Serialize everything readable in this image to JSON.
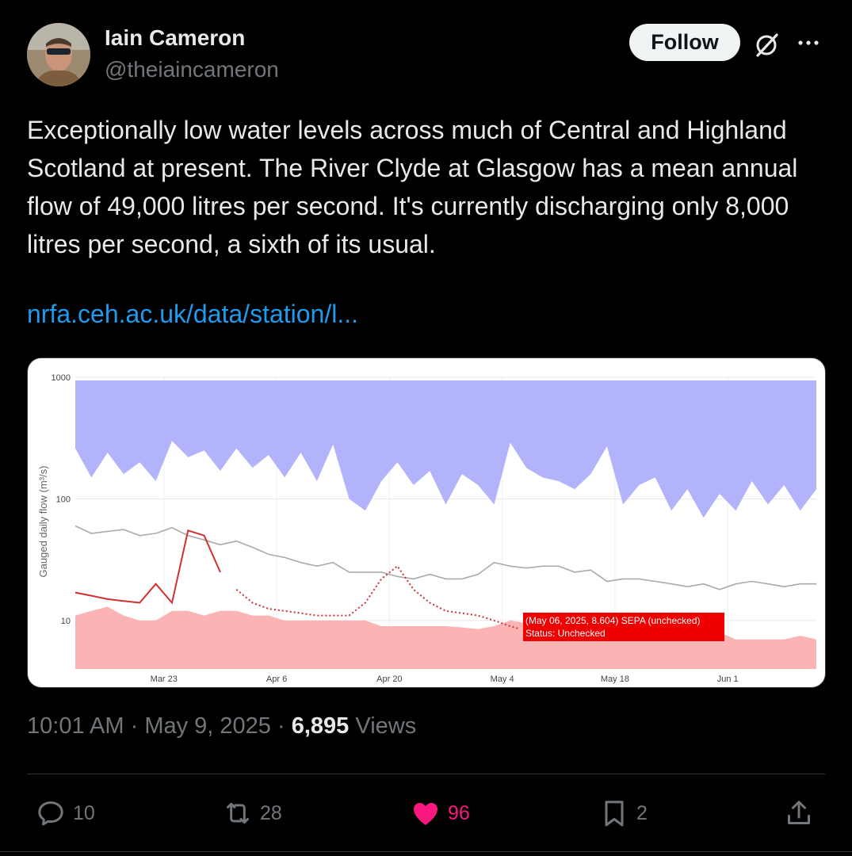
{
  "author": {
    "name": "Iain Cameron",
    "handle": "@theiaincameron"
  },
  "header": {
    "follow_label": "Follow",
    "grok_icon": "grok-icon",
    "more_icon": "more-icon"
  },
  "tweet": {
    "text": "Exceptionally low water levels across much of Central and Highland Scotland at present. The River Clyde at Glasgow has a mean annual flow of 49,000 litres per second. It's currently discharging only 8,000 litres per second, a sixth of its usual.",
    "link": "nrfa.ceh.ac.uk/data/station/l..."
  },
  "chart_data": {
    "type": "area",
    "ylabel": "Gauged daily flow (m³/s)",
    "yscale": "log",
    "ylim": [
      4,
      1000
    ],
    "ytick_labels": [
      "1000",
      "100",
      "10"
    ],
    "yticks": [
      1000,
      100,
      10
    ],
    "xtick_labels": [
      "Mar 23",
      "Apr 6",
      "Apr 20",
      "May 4",
      "May 18",
      "Jun 1"
    ],
    "xlim_days": [
      "2025-03-12",
      "2025-06-12"
    ],
    "grid": true,
    "series": [
      {
        "style": "band-upper",
        "color": "#b3b3fb",
        "x": [
          "2025-03-12",
          "2025-03-14",
          "2025-03-16",
          "2025-03-18",
          "2025-03-20",
          "2025-03-22",
          "2025-03-24",
          "2025-03-26",
          "2025-03-28",
          "2025-03-30",
          "2025-04-01",
          "2025-04-03",
          "2025-04-05",
          "2025-04-07",
          "2025-04-09",
          "2025-04-11",
          "2025-04-13",
          "2025-04-15",
          "2025-04-17",
          "2025-04-19",
          "2025-04-21",
          "2025-04-23",
          "2025-04-25",
          "2025-04-27",
          "2025-04-29",
          "2025-05-01",
          "2025-05-03",
          "2025-05-05",
          "2025-05-07",
          "2025-05-09",
          "2025-05-11",
          "2025-05-13",
          "2025-05-15",
          "2025-05-17",
          "2025-05-19",
          "2025-05-21",
          "2025-05-23",
          "2025-05-25",
          "2025-05-27",
          "2025-05-29",
          "2025-05-31",
          "2025-06-02",
          "2025-06-04",
          "2025-06-06",
          "2025-06-08",
          "2025-06-10",
          "2025-06-12"
        ],
        "values": [
          260,
          150,
          240,
          160,
          200,
          140,
          300,
          220,
          250,
          170,
          260,
          180,
          230,
          150,
          240,
          140,
          280,
          100,
          80,
          140,
          200,
          130,
          170,
          90,
          160,
          130,
          90,
          290,
          180,
          150,
          140,
          120,
          160,
          270,
          90,
          130,
          150,
          80,
          120,
          70,
          110,
          80,
          140,
          90,
          130,
          80,
          120
        ]
      },
      {
        "style": "band-lower",
        "color": "#fbb3b3",
        "x": [
          "2025-03-12",
          "2025-03-14",
          "2025-03-16",
          "2025-03-18",
          "2025-03-20",
          "2025-03-22",
          "2025-03-24",
          "2025-03-26",
          "2025-03-28",
          "2025-03-30",
          "2025-04-01",
          "2025-04-03",
          "2025-04-05",
          "2025-04-07",
          "2025-04-09",
          "2025-04-11",
          "2025-04-13",
          "2025-04-15",
          "2025-04-17",
          "2025-04-19",
          "2025-04-21",
          "2025-04-23",
          "2025-04-25",
          "2025-04-27",
          "2025-04-29",
          "2025-05-01",
          "2025-05-03",
          "2025-05-05",
          "2025-05-07",
          "2025-05-09",
          "2025-05-11",
          "2025-05-13",
          "2025-05-15",
          "2025-05-17",
          "2025-05-19",
          "2025-05-21",
          "2025-05-23",
          "2025-05-25",
          "2025-05-27",
          "2025-05-29",
          "2025-05-31",
          "2025-06-02",
          "2025-06-04",
          "2025-06-06",
          "2025-06-08",
          "2025-06-10",
          "2025-06-12"
        ],
        "values": [
          11,
          12,
          13,
          11,
          10,
          10,
          12,
          12,
          11,
          12,
          12,
          11,
          11,
          10,
          10,
          10,
          10,
          10,
          10,
          9,
          9,
          9,
          9,
          9,
          8.8,
          8.5,
          9,
          10,
          9.5,
          9,
          9,
          8.5,
          8.5,
          8.5,
          8.5,
          8.5,
          8.5,
          8.5,
          8,
          8,
          8,
          7,
          7,
          7,
          7,
          7.5,
          7
        ]
      },
      {
        "style": "mean",
        "color": "#aaaaaa",
        "x": [
          "2025-03-12",
          "2025-03-14",
          "2025-03-16",
          "2025-03-18",
          "2025-03-20",
          "2025-03-22",
          "2025-03-24",
          "2025-03-26",
          "2025-03-28",
          "2025-03-30",
          "2025-04-01",
          "2025-04-03",
          "2025-04-05",
          "2025-04-07",
          "2025-04-09",
          "2025-04-11",
          "2025-04-13",
          "2025-04-15",
          "2025-04-17",
          "2025-04-19",
          "2025-04-21",
          "2025-04-23",
          "2025-04-25",
          "2025-04-27",
          "2025-04-29",
          "2025-05-01",
          "2025-05-03",
          "2025-05-05",
          "2025-05-07",
          "2025-05-09",
          "2025-05-11",
          "2025-05-13",
          "2025-05-15",
          "2025-05-17",
          "2025-05-19",
          "2025-05-21",
          "2025-05-23",
          "2025-05-25",
          "2025-05-27",
          "2025-05-29",
          "2025-05-31",
          "2025-06-02",
          "2025-06-04",
          "2025-06-06",
          "2025-06-08",
          "2025-06-10",
          "2025-06-12"
        ],
        "values": [
          60,
          52,
          54,
          56,
          50,
          52,
          58,
          50,
          46,
          42,
          45,
          40,
          35,
          33,
          30,
          28,
          30,
          25,
          25,
          25,
          23,
          22,
          24,
          22,
          22,
          24,
          30,
          28,
          27,
          28,
          28,
          25,
          26,
          21,
          22,
          22,
          21,
          20,
          19,
          20,
          18,
          20,
          21,
          20,
          19,
          20,
          20
        ]
      },
      {
        "style": "observed",
        "color": "#d03030",
        "x": [
          "2025-03-12",
          "2025-03-14",
          "2025-03-16",
          "2025-03-18",
          "2025-03-20",
          "2025-03-22",
          "2025-03-24",
          "2025-03-26",
          "2025-03-28",
          "2025-03-30"
        ],
        "values": [
          17,
          16,
          15,
          14.5,
          14,
          20,
          14,
          55,
          50,
          25
        ]
      },
      {
        "style": "observed-unchecked",
        "color": "#d03030",
        "x": [
          "2025-04-01",
          "2025-04-03",
          "2025-04-05",
          "2025-04-07",
          "2025-04-09",
          "2025-04-11",
          "2025-04-13",
          "2025-04-15",
          "2025-04-17",
          "2025-04-19",
          "2025-04-21",
          "2025-04-23",
          "2025-04-25",
          "2025-04-27",
          "2025-04-29",
          "2025-05-01",
          "2025-05-03",
          "2025-05-05",
          "2025-05-06"
        ],
        "values": [
          18,
          14,
          12.5,
          12,
          11.5,
          11,
          11,
          11,
          14,
          22,
          28,
          18,
          14,
          12,
          11.5,
          11,
          10,
          9,
          8.604
        ]
      }
    ],
    "tooltip": {
      "line1": "(May 06, 2025, 8.604) SEPA (unchecked)",
      "line2": "Status: Unchecked",
      "x": "2025-05-06",
      "y": 8.604,
      "color": "#ee0000"
    }
  },
  "meta": {
    "time": "10:01 AM",
    "date": "May 9, 2025",
    "separator": "·",
    "views_count": "6,895",
    "views_label": "Views"
  },
  "actions": {
    "replies": "10",
    "reposts": "28",
    "likes": "96",
    "bookmarks": "2"
  }
}
